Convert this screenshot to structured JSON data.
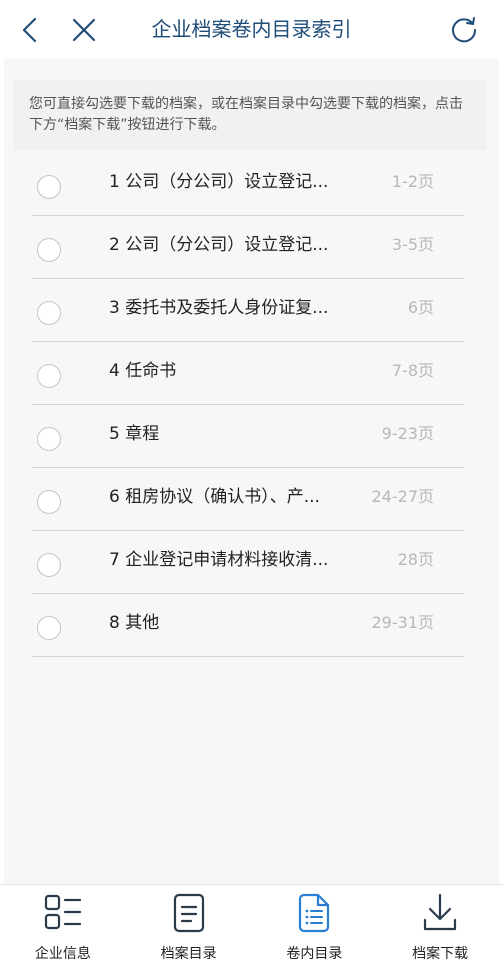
{
  "header": {
    "title": "企业档案卷内目录索引",
    "back_icon": "chevron-left-icon",
    "close_icon": "close-icon",
    "refresh_icon": "refresh-icon"
  },
  "notice": {
    "text": "您可直接勾选要下载的档案，或在档案目录中勾选要下载的档案，点击下方“档案下载”按钮进行下载。"
  },
  "items": [
    {
      "title": "1 公司（分公司）设立登记...",
      "pages": "1-2页"
    },
    {
      "title": "2 公司（分公司）设立登记...",
      "pages": "3-5页"
    },
    {
      "title": "3 委托书及委托人身份证复...",
      "pages": "6页"
    },
    {
      "title": "4 任命书",
      "pages": "7-8页"
    },
    {
      "title": "5 章程",
      "pages": "9-23页"
    },
    {
      "title": "6 租房协议（确认书）、产...",
      "pages": "24-27页"
    },
    {
      "title": "7 企业登记申请材料接收清...",
      "pages": "28页"
    },
    {
      "title": "8 其他",
      "pages": "29-31页"
    }
  ],
  "bottom_nav": [
    {
      "label": "企业信息",
      "icon": "grid-list-icon",
      "active": false
    },
    {
      "label": "档案目录",
      "icon": "document-icon",
      "active": false
    },
    {
      "label": "卷内目录",
      "icon": "document-list-icon",
      "active": true
    },
    {
      "label": "档案下载",
      "icon": "download-icon",
      "active": false
    }
  ],
  "colors": {
    "title": "#1f4d7a",
    "accent": "#2a7fd4",
    "icon_dark": "#2b3a4a",
    "page_text": "#b8b8b8"
  }
}
